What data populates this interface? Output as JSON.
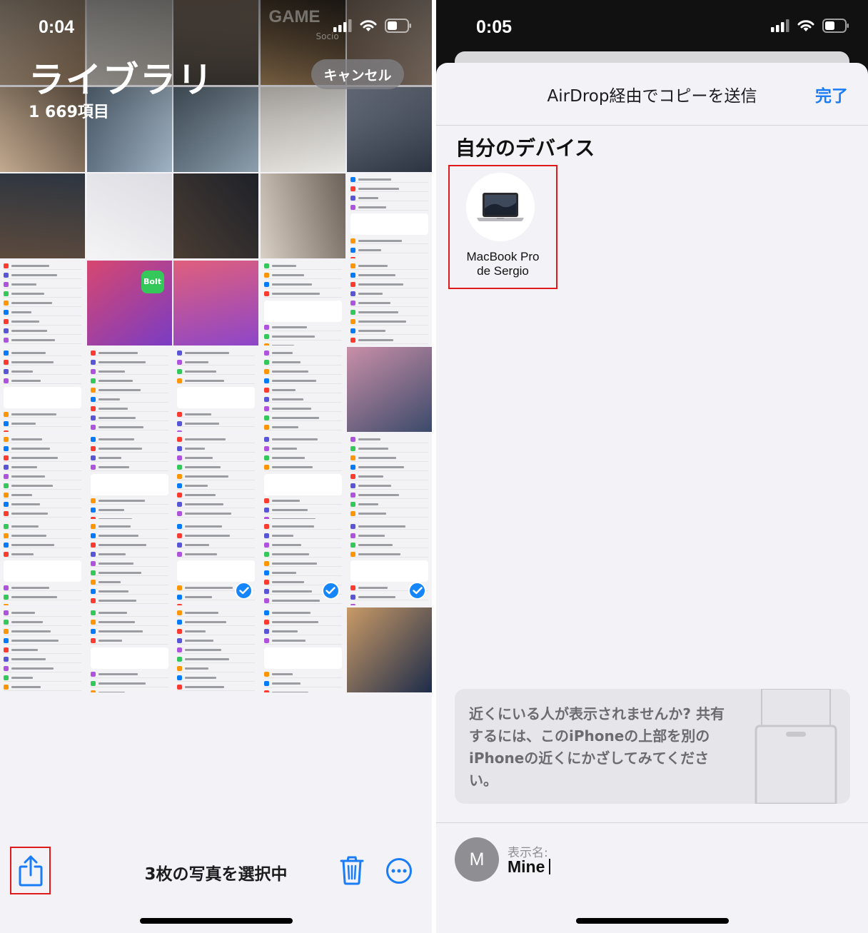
{
  "left": {
    "status_time": "0:04",
    "library_title": "ライブラリ",
    "item_count": "1 669項目",
    "cancel_label": "キャンセル",
    "selected_label": "3枚の写真を選択中",
    "icons": [
      "share-icon",
      "trash-icon",
      "more-icon",
      "checkmark-icon"
    ],
    "photo_thumbnails": [
      {
        "text": "GAME",
        "subtext": "Socio"
      },
      {
        "text": "Bolt"
      }
    ],
    "selected_count": 3
  },
  "right": {
    "status_time": "0:05",
    "sheet_title": "AirDrop経由でコピーを送信",
    "done_label": "完了",
    "section_title": "自分のデバイス",
    "device_name_line1": "MacBook Pro",
    "device_name_line2": "de Sergio",
    "hint_text": "近くにいる人が表示されませんか? 共有するには、このiPhoneの上部を別のiPhoneの近くにかざしてみてください。",
    "display_name_label": "表示名:",
    "display_name_value": "Mine",
    "avatar_initial": "M"
  },
  "colors": {
    "accent_blue": "#1a7cf7",
    "check_blue": "#1686ff",
    "highlight_red": "#e0191c",
    "sheet_bg": "#f2f2f7"
  }
}
